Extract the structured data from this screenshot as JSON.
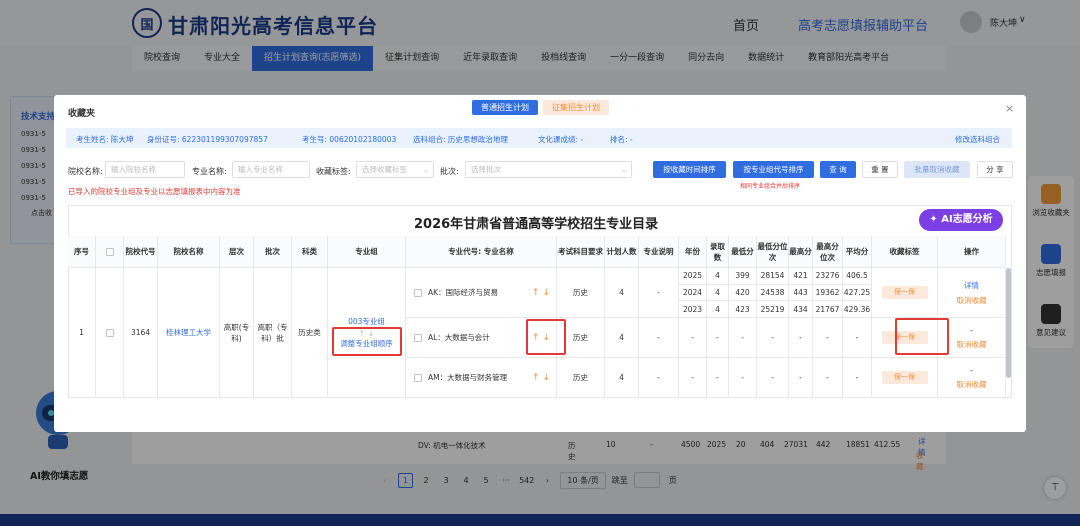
{
  "header": {
    "logo_char": "国",
    "site_name": "甘肃阳光高考信息平台",
    "home": "首页",
    "aux": "高考志愿填报辅助平台",
    "user": "陈大坤"
  },
  "nav": [
    "院校查询",
    "专业大全",
    "招生计划查询(志愿筛选)",
    "征集计划查询",
    "近年录取查询",
    "投档线查询",
    "一分一段查询",
    "同分去向",
    "数据统计",
    "教育部阳光高考平台"
  ],
  "nav_active": 2,
  "left_panel": {
    "title": "技术支持",
    "phones": [
      "0931-5",
      "0931-5",
      "0931-5",
      "0931-5",
      "0931-5"
    ],
    "link": "点击收"
  },
  "right_panel": [
    "浏览收藏夹",
    "志愿填报",
    "意见建议"
  ],
  "robot_caption": "AI教你填志愿",
  "bg_row": {
    "code": "DV",
    "name": "机电一体化技术",
    "subj": "历史",
    "plan": "10",
    "dash": "-",
    "score": "4500",
    "year": "2025",
    "adm": "20",
    "min": "404",
    "minpos": "27031",
    "max": "442",
    "maxpos": "18851",
    "avg": "412.55",
    "ops": [
      "详情",
      "收藏"
    ]
  },
  "pager": {
    "pages": [
      "1",
      "2",
      "3",
      "4",
      "5",
      "···",
      "542"
    ],
    "size": "10 条/页",
    "goto": "跳至",
    "page_word": "页"
  },
  "modal": {
    "title": "收藏夹",
    "tabs": [
      "普通招生计划",
      "征集招生计划"
    ],
    "info": {
      "name": "考生姓名: 陈大坤",
      "id": "身份证号: 622301199307097857",
      "exam": "考生号: 00620102180003",
      "combo": "选科组合: 历史思想政治地理",
      "score": "文化课成绩: -",
      "rank": "排名: -",
      "edit": "修改选科组合"
    },
    "filters": {
      "school_label": "院校名称:",
      "school_ph": "输入院校名称",
      "major_label": "专业名称:",
      "major_ph": "输入专业名称",
      "tag_label": "收藏标签:",
      "tag_ph": "选择收藏标签",
      "batch_label": "批次:",
      "batch_ph": "选择批次"
    },
    "buttons": {
      "by_time": "按收藏时间排序",
      "by_code": "按专业组代号排序",
      "search": "查 询",
      "reset": "重 置",
      "batch_cancel": "批量取消收藏",
      "share": "分 享"
    },
    "sort_note": "相同专业组合并后排序",
    "warning": "已导入的院校专业组及专业以志愿填报表中内容为准",
    "table_title": "2026年甘肃省普通高等学校招生专业目录",
    "ai_btn": "AI志愿分析",
    "headers": [
      "序号",
      "",
      "院校代号",
      "院校名称",
      "层次",
      "批次",
      "科类",
      "专业组",
      "专业代号: 专业名称",
      "考试科目要求",
      "计划人数",
      "专业说明",
      "年份",
      "录取数",
      "最低分",
      "最低分位次",
      "最高分",
      "最高分位次",
      "平均分",
      "收藏标签",
      "操作"
    ],
    "row": {
      "index": "1",
      "code": "3164",
      "school": "桂林理工大学",
      "level": "高职(专科)",
      "batch": "高职（专科）批",
      "type": "历史类",
      "group": "003专业组",
      "adjust": "调整专业组顺序"
    },
    "majors": [
      {
        "name": "AK：国际经济与贸易",
        "subj": "历史",
        "plan": "4",
        "desc": "-",
        "years": [
          {
            "year": "2025",
            "adm": "4",
            "min": "399",
            "minpos": "28154",
            "max": "421",
            "maxpos": "23276",
            "avg": "406.5"
          },
          {
            "year": "2024",
            "adm": "4",
            "min": "420",
            "minpos": "24538",
            "max": "443",
            "maxpos": "19362",
            "avg": "427.25"
          },
          {
            "year": "2023",
            "adm": "4",
            "min": "423",
            "minpos": "25219",
            "max": "434",
            "maxpos": "21767",
            "avg": "429.36"
          }
        ],
        "tag": "保一保",
        "ops": [
          "详情",
          "取消收藏"
        ]
      },
      {
        "name": "AL：大数据与会计",
        "subj": "历史",
        "plan": "4",
        "desc": "-",
        "dash": "-",
        "tag": "保一保",
        "ops": [
          "-",
          "取消收藏"
        ]
      },
      {
        "name": "AM：大数据与财务管理",
        "subj": "历史",
        "plan": "4",
        "desc": "-",
        "dash": "-",
        "tag": "保一保",
        "ops": [
          "-",
          "取消收藏"
        ]
      }
    ]
  },
  "colors": {
    "brand": "#1a3a8a",
    "primary": "#2f6de0",
    "tag_bg": "#fde9dc",
    "tag_fg": "#f08c3a",
    "danger": "#e53935"
  }
}
